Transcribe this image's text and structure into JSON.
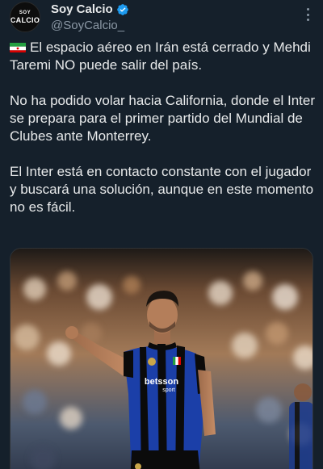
{
  "account": {
    "display_name": "Soy Calcio",
    "handle": "@SoyCalcio_",
    "avatar_text_top": "SOY",
    "avatar_text_bottom": "CALCIO",
    "verified_color": "#1d9bf0"
  },
  "tweet": {
    "paragraphs": [
      "El espacio aéreo en Irán está cerrado y Mehdi Taremi NO puede salir del país.",
      "No ha podido volar hacia California, donde el Inter se prepara para el primer partido del Mundial de Clubes ante Monterrey.",
      "El Inter está en contacto constante con el jugador y buscará una solución, aunque en este momento no es fácil."
    ],
    "flag_icon": "iran-flag-icon"
  },
  "media": {
    "sponsor_text": "betsson",
    "sponsor_subtext": "sport",
    "jersey_colors": [
      "#1b3fa8",
      "#0b0b0b"
    ]
  },
  "colors": {
    "background": "#15202b",
    "text_primary": "#e7e9ea",
    "text_secondary": "#8b98a5"
  }
}
